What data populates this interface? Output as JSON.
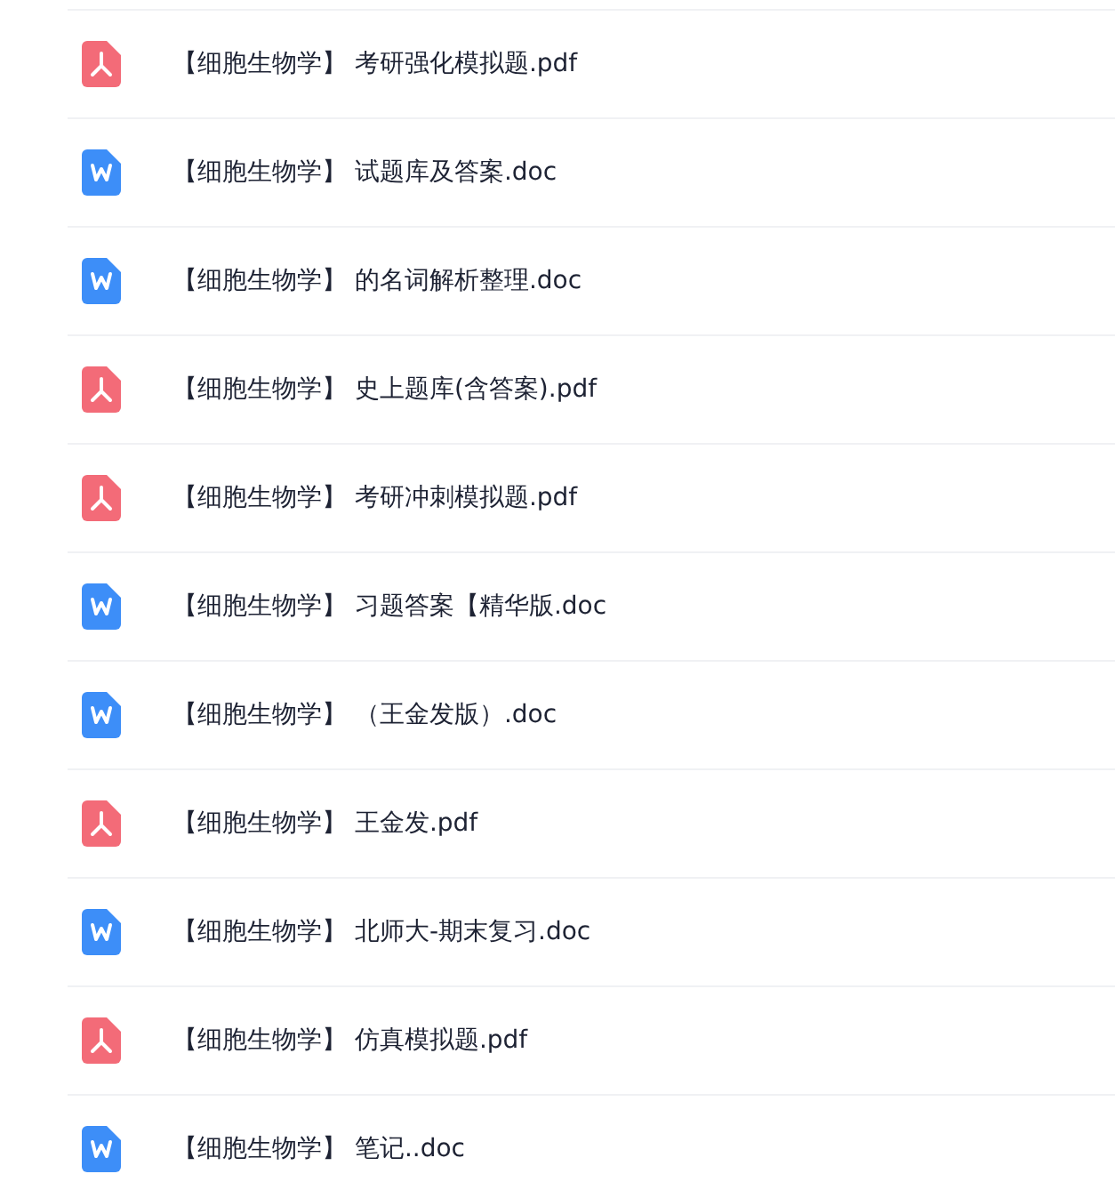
{
  "files": [
    {
      "kind": "pdf",
      "name": "【细胞生物学】 考研强化模拟题.pdf"
    },
    {
      "kind": "doc",
      "name": "【细胞生物学】 试题库及答案.doc"
    },
    {
      "kind": "doc",
      "name": "【细胞生物学】 的名词解析整理.doc"
    },
    {
      "kind": "pdf",
      "name": "【细胞生物学】 史上题库(含答案).pdf"
    },
    {
      "kind": "pdf",
      "name": "【细胞生物学】 考研冲刺模拟题.pdf"
    },
    {
      "kind": "doc",
      "name": "【细胞生物学】 习题答案【精华版.doc"
    },
    {
      "kind": "doc",
      "name": "【细胞生物学】 （王金发版）.doc"
    },
    {
      "kind": "pdf",
      "name": "【细胞生物学】 王金发.pdf"
    },
    {
      "kind": "doc",
      "name": "【细胞生物学】 北师大-期末复习.doc"
    },
    {
      "kind": "pdf",
      "name": "【细胞生物学】 仿真模拟题.pdf"
    },
    {
      "kind": "doc",
      "name": "【细胞生物学】 笔记..doc"
    }
  ]
}
